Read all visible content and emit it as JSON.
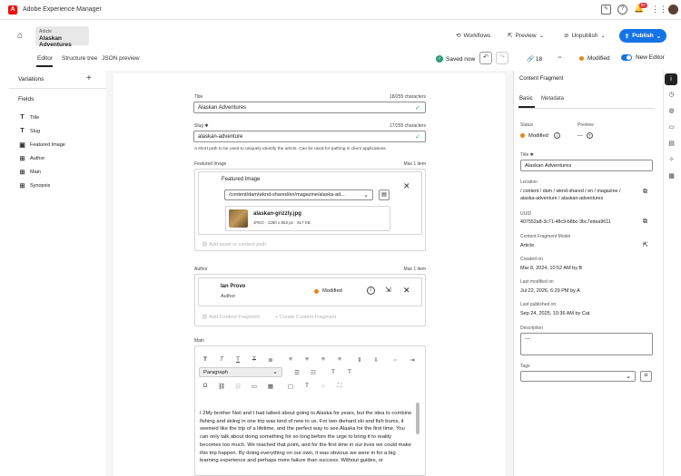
{
  "app": {
    "title": "Adobe Experience Manager",
    "logo_letter": "A",
    "notification_count": "9+"
  },
  "header": {
    "article_type": "Article",
    "article_name": "Alaskan Adventures",
    "workflows": "Workflows",
    "preview": "Preview",
    "unpublish": "Unpublish",
    "publish": "Publish"
  },
  "tabs": [
    {
      "label": "Editor"
    },
    {
      "label": "Structure tree"
    },
    {
      "label": "JSON preview"
    }
  ],
  "toolbar": {
    "saved": "Saved now",
    "references": "18",
    "status": "Modified",
    "new_editor": "New Editor"
  },
  "left_panel": {
    "variations": "Variations",
    "fields_label": "Fields",
    "fields": [
      {
        "label": "Title",
        "icon": "T"
      },
      {
        "label": "Slug",
        "icon": "T"
      },
      {
        "label": "Featured Image",
        "icon": "▣"
      },
      {
        "label": "Author",
        "icon": "⊞"
      },
      {
        "label": "Main",
        "icon": "⊞"
      },
      {
        "label": "Synopsis",
        "icon": "⊞"
      }
    ]
  },
  "form": {
    "title_label": "Title",
    "title_count": "18/255 characters",
    "title_value": "Alaskan Adventures",
    "slug_label": "Slug ✱",
    "slug_count": "17/255 characters",
    "slug_value": "alaskan-adventure",
    "slug_help": "A short path to be used to uniquely identify the article. Can be used for pathing in client applications.",
    "featured_label": "Featured Image",
    "featured_max": "Max 1 item",
    "featured_inner_label": "Featured Image",
    "featured_path": "/content/dam/wknd-shared/en/magazine/alaska-ad...",
    "asset_name": "alaskan-grizzly.jpg",
    "asset_meta": "JPEG · 1280 x 853 px · 317 KB",
    "add_asset": "Add asset or content path",
    "author_label": "Author",
    "author_max": "Max 1 item",
    "author_name": "Ian Provo",
    "author_role": "Author",
    "author_status": "Modified",
    "add_fragment": "Add Content Fragment",
    "create_fragment": "Create Content Fragment",
    "main_label": "Main",
    "paragraph_style": "Paragraph",
    "main_text": "I 2My brother Neil and I had talked about going to Alaska for years, but the idea to combine fishing and skiing in one trip was kind of new to us. For two diehard ski and fish bums, it seemed like the trip of a lifetime, and the perfect way to see Alaska for the first time. You can only talk about doing something for so long before the urge to bring it to reality becomes too much. We reached that point, and for the first time in our lives we could make this trip happen. By doing everything on our own, it was obvious we were in for a big learning experience and perhaps more failure than success. Without guides, or"
  },
  "right_panel": {
    "header": "Content Fragment",
    "tab_basic": "Basic",
    "tab_metadata": "Metadata",
    "status_label": "Status",
    "status_value": "Modified",
    "preview_label": "Preview",
    "preview_value": "—",
    "title_label": "Title ✱",
    "title_value": "Alaskan Adventures",
    "location_label": "Location",
    "location_value": "/ content / dam / wknd-shared / en / magazine / alaska-adventure / alaskan-adventures",
    "uuid_label": "UUID",
    "uuid_value": "407552a8-3c71-48c9-b8bc-3bc7edea9611",
    "model_label": "Content Fragment Model",
    "model_value": "Article",
    "created_label": "Created on",
    "created_value": "Mar 8, 2024, 10:52 AM by B",
    "modified_label": "Last modified on",
    "modified_value": "Jul 22, 2026, 6:29 PM by A",
    "published_label": "Last published on",
    "published_value": "Sep 24, 2025, 10:36 AM by Cat",
    "description_label": "Description",
    "description_value": "---",
    "tags_label": "Tags"
  },
  "colors": {
    "accent": "#1473e6",
    "modified": "#e68619",
    "success": "#2d9d78",
    "brand": "#eb1000"
  }
}
